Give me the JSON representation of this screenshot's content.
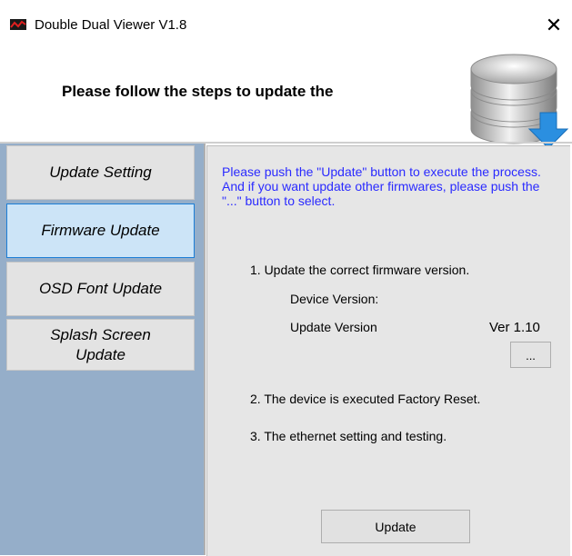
{
  "window": {
    "title": "Double Dual Viewer V1.8",
    "close_glyph": "✕",
    "icon": "app-logo-icon"
  },
  "header": {
    "text": "Please follow the steps to update the",
    "icon": "database-download-icon"
  },
  "sidebar": {
    "items": [
      {
        "label": "Update Setting",
        "active": false
      },
      {
        "label": "Firmware Update",
        "active": true
      },
      {
        "label": "OSD Font Update",
        "active": false
      },
      {
        "label": "Splash Screen Update",
        "active": false
      }
    ]
  },
  "content": {
    "intro": "Please push the \"Update\" button to execute the process. And if you want update other firmwares, please push the \"...\" button to select.",
    "step1": "1. Update the correct firmware version.",
    "device_version_label": "Device Version:",
    "update_version_label": "Update Version",
    "update_version_value": "Ver 1.10",
    "browse_button": "...",
    "step2": "2. The device is executed Factory Reset.",
    "step3": "3. The ethernet setting and testing.",
    "update_button": "Update"
  },
  "colors": {
    "sidebar_bg": "#95aec9",
    "active_item_bg": "#cce4f7",
    "active_item_border": "#1c7ed6",
    "intro_text": "#2a2aff",
    "content_bg": "#e6e6e6"
  }
}
